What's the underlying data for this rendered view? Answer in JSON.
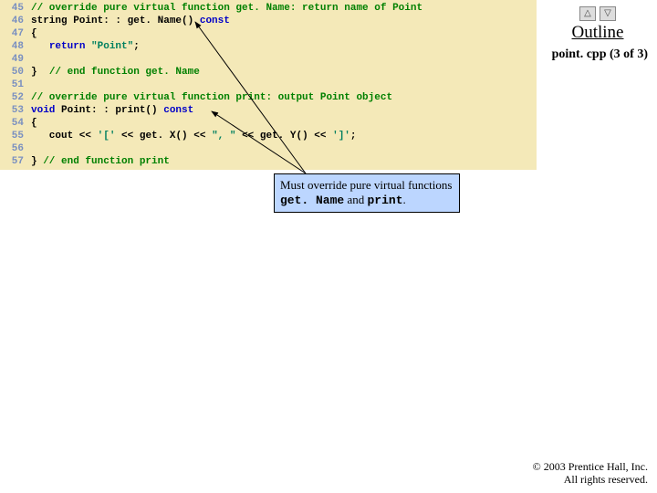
{
  "outline": {
    "title": "Outline"
  },
  "nav": {
    "up": "△",
    "down": "▽"
  },
  "page_indicator": "point. cpp (3 of 3)",
  "code": {
    "lines": [
      {
        "n": "45",
        "segs": [
          {
            "cls": "c-comment",
            "t": "// override pure virtual function get. Name: return name of Point"
          }
        ]
      },
      {
        "n": "46",
        "segs": [
          {
            "cls": "c-plain",
            "t": "string Point: : get. Name() "
          },
          {
            "cls": "c-kw",
            "t": "const"
          }
        ]
      },
      {
        "n": "47",
        "segs": [
          {
            "cls": "c-plain",
            "t": "{"
          }
        ]
      },
      {
        "n": "48",
        "segs": [
          {
            "cls": "c-plain",
            "t": "   "
          },
          {
            "cls": "c-kw",
            "t": "return"
          },
          {
            "cls": "c-plain",
            "t": " "
          },
          {
            "cls": "c-str",
            "t": "\"Point\""
          },
          {
            "cls": "c-plain",
            "t": ";"
          }
        ]
      },
      {
        "n": "49",
        "segs": [
          {
            "cls": "c-plain",
            "t": ""
          }
        ]
      },
      {
        "n": "50",
        "segs": [
          {
            "cls": "c-plain",
            "t": "}  "
          },
          {
            "cls": "c-comment",
            "t": "// end function get. Name"
          }
        ]
      },
      {
        "n": "51",
        "segs": [
          {
            "cls": "c-plain",
            "t": ""
          }
        ]
      },
      {
        "n": "52",
        "segs": [
          {
            "cls": "c-comment",
            "t": "// override pure virtual function print: output Point object"
          }
        ]
      },
      {
        "n": "53",
        "segs": [
          {
            "cls": "c-kw",
            "t": "void"
          },
          {
            "cls": "c-plain",
            "t": " Point: : print() "
          },
          {
            "cls": "c-kw",
            "t": "const"
          }
        ]
      },
      {
        "n": "54",
        "segs": [
          {
            "cls": "c-plain",
            "t": "{"
          }
        ]
      },
      {
        "n": "55",
        "segs": [
          {
            "cls": "c-plain",
            "t": "   cout << "
          },
          {
            "cls": "c-str",
            "t": "'['"
          },
          {
            "cls": "c-plain",
            "t": " << get. X() << "
          },
          {
            "cls": "c-str",
            "t": "\", \""
          },
          {
            "cls": "c-plain",
            "t": " << get. Y() << "
          },
          {
            "cls": "c-str",
            "t": "']'"
          },
          {
            "cls": "c-plain",
            "t": ";"
          }
        ]
      },
      {
        "n": "56",
        "segs": [
          {
            "cls": "c-plain",
            "t": ""
          }
        ]
      },
      {
        "n": "57",
        "segs": [
          {
            "cls": "c-plain",
            "t": "} "
          },
          {
            "cls": "c-comment",
            "t": "// end function print"
          }
        ]
      }
    ]
  },
  "callout": {
    "pre": "Must override pure virtual functions ",
    "fn1": "get. Name",
    "mid": " and ",
    "fn2": "print",
    "post": "."
  },
  "copyright": {
    "line1": "© 2003 Prentice Hall, Inc.",
    "line2": "All rights reserved."
  }
}
